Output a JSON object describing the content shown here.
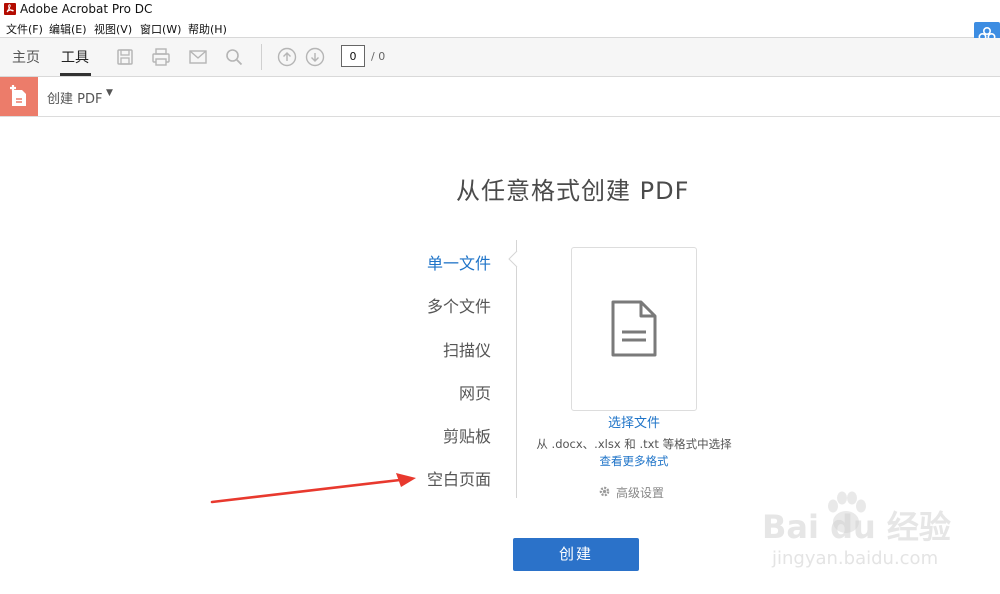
{
  "window": {
    "title": "Adobe Acrobat Pro DC"
  },
  "menubar": {
    "items": [
      "文件(F)",
      "编辑(E)",
      "视图(V)",
      "窗口(W)",
      "帮助(H)"
    ]
  },
  "toolbar": {
    "tabs": [
      {
        "label": "主页",
        "active": false
      },
      {
        "label": "工具",
        "active": true
      }
    ],
    "icons": [
      "save-icon",
      "print-icon",
      "mail-icon",
      "search-icon",
      "page-up-icon",
      "page-down-icon"
    ],
    "page_current": "0",
    "page_total": "/ 0"
  },
  "createbar": {
    "label": "创建 PDF"
  },
  "main": {
    "heading": "从任意格式创建 PDF",
    "options": [
      {
        "label": "单一文件",
        "active": true
      },
      {
        "label": "多个文件",
        "active": false
      },
      {
        "label": "扫描仪",
        "active": false
      },
      {
        "label": "网页",
        "active": false
      },
      {
        "label": "剪贴板",
        "active": false
      },
      {
        "label": "空白页面",
        "active": false
      }
    ],
    "choose_file": "选择文件",
    "formats_hint": "从 .docx、.xlsx 和 .txt 等格式中选择",
    "more_formats": "查看更多格式",
    "advanced_settings": "高级设置",
    "create_button": "创建"
  },
  "watermark": {
    "main": "Bai du 经验",
    "sub": "jingyan.baidu.com"
  },
  "colors": {
    "accent_blue": "#2b72c9",
    "link_blue": "#1f74c8",
    "create_tool_red": "#ec7c6a",
    "annotation_red": "#e8392e"
  }
}
